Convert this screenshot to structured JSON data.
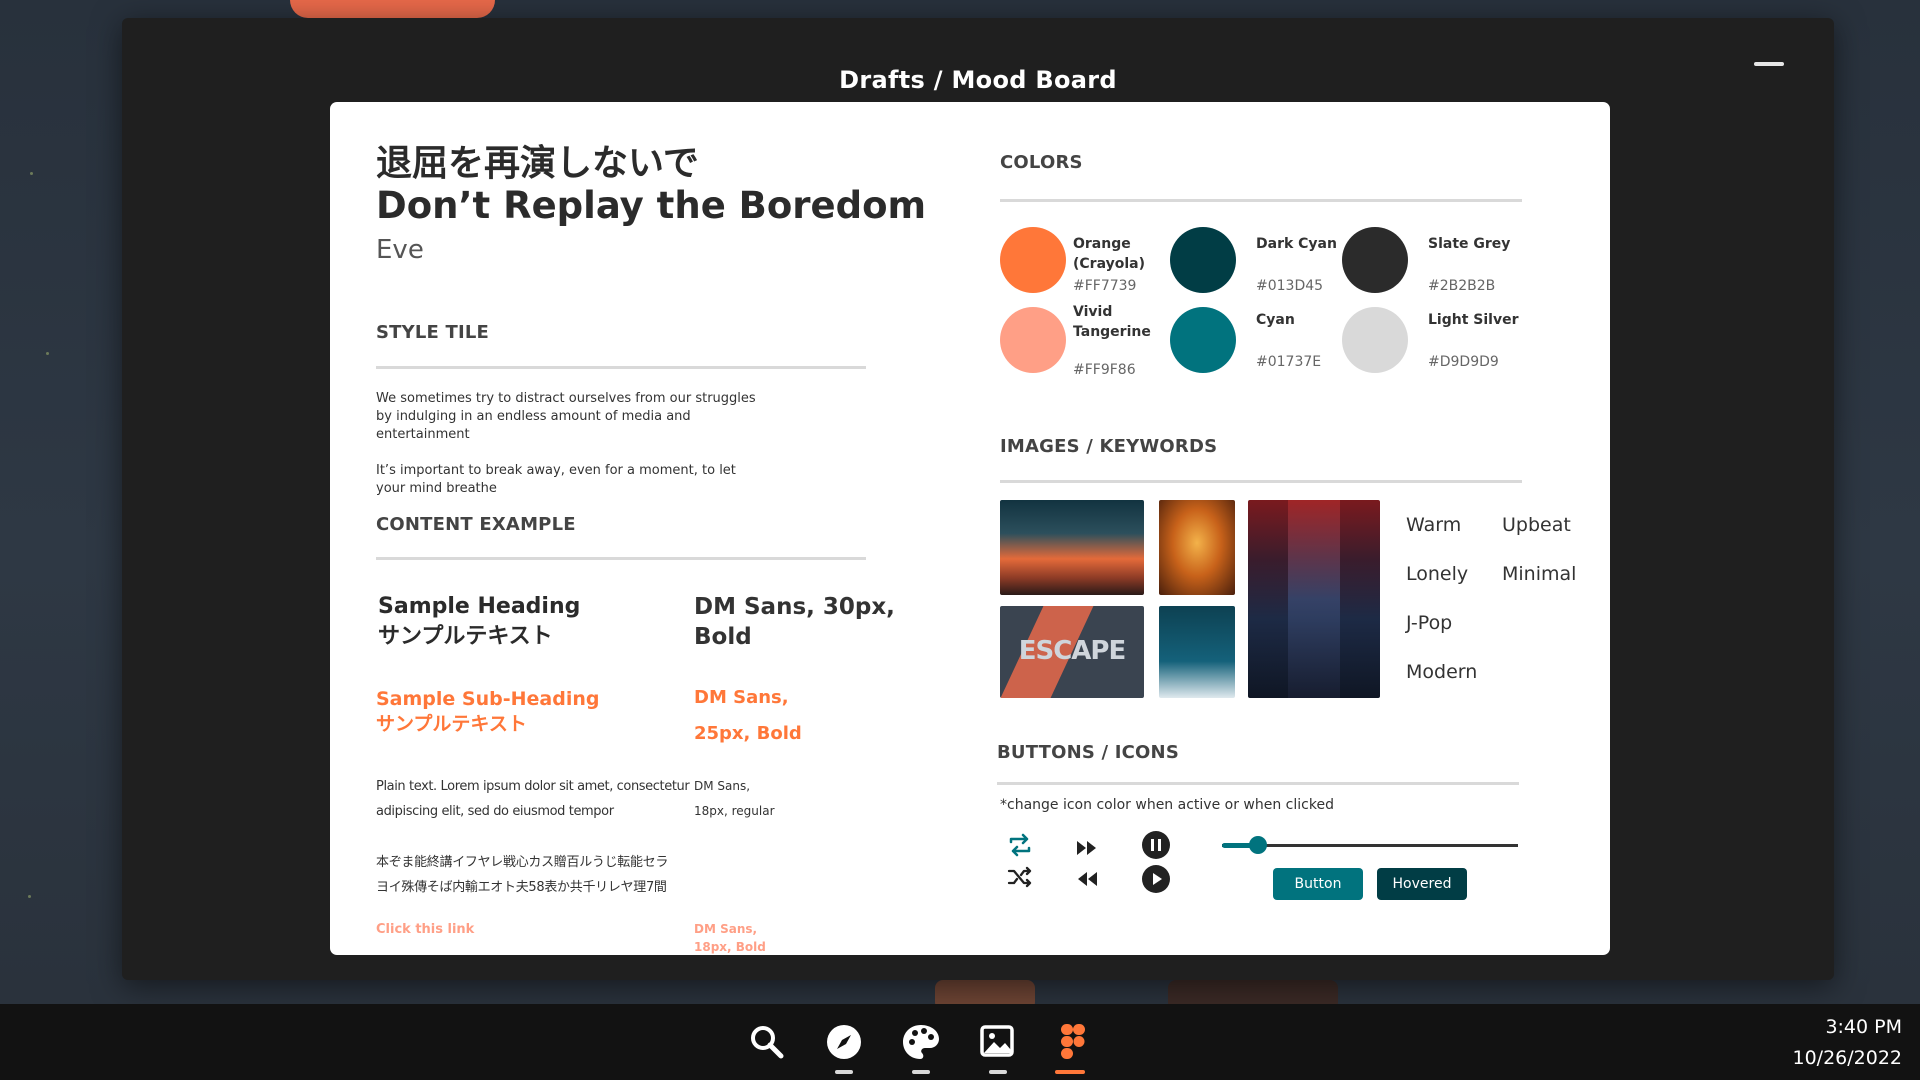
{
  "window": {
    "title": "Drafts / Mood Board"
  },
  "board": {
    "title_jp": "退屈を再演しないで",
    "title_en": "Don’t Replay the Boredom",
    "author": "Eve",
    "style_tile": {
      "heading": "STYLE TILE",
      "paragraphs": [
        "We sometimes try to distract ourselves from our struggles by indulging in an endless amount of media and entertainment",
        "It’s important to break away, even for a moment, to let your mind breathe"
      ]
    },
    "content_example": {
      "heading": "CONTENT EXAMPLE",
      "sample_heading": "Sample Heading",
      "sample_heading_jp": "サンプルテキスト",
      "heading_spec_1": "DM Sans, 30px,",
      "heading_spec_2": "Bold",
      "sample_sub": "Sample Sub-Heading",
      "sample_sub_jp": "サンプルテキスト",
      "sub_spec_1": "DM Sans,",
      "sub_spec_2": "25px, Bold",
      "plain_1": "Plain text. Lorem ipsum dolor sit amet, consectetur",
      "plain_2": "adipiscing elit, sed do eiusmod tempor",
      "plain_spec_1": "DM Sans,",
      "plain_spec_2": "18px, regular",
      "jp_1": "本ぞま能終講イフヤレ戦心カス贈百ルうじ転能セラ",
      "jp_2": "ヨイ殊傳そば内輸エオト夫58表か共千リレヤ理7間",
      "link": "Click this link",
      "link_spec_1": "DM Sans,",
      "link_spec_2": "18px, Bold"
    },
    "colors": {
      "heading": "COLORS",
      "items": [
        {
          "name": "Orange (Crayola)",
          "hex": "#FF7739"
        },
        {
          "name": "Vivid Tangerine",
          "hex": "#FF9F86"
        },
        {
          "name": "Dark Cyan",
          "hex": "#013D45"
        },
        {
          "name": "Cyan",
          "hex": "#01737E"
        },
        {
          "name": "Slate Grey",
          "hex": "#2B2B2B"
        },
        {
          "name": "Light Silver",
          "hex": "#D9D9D9"
        }
      ]
    },
    "images": {
      "heading": "IMAGES / KEYWORDS",
      "escape_text": "ESCAPE",
      "keywords": [
        "Warm",
        "Upbeat",
        "Lonely",
        "Minimal",
        "J-Pop",
        "Modern"
      ]
    },
    "buttons": {
      "heading": "BUTTONS / ICONS",
      "note": "*change icon color when active or when clicked",
      "slider_value": 0.12,
      "button_label": "Button",
      "hovered_label": "Hovered",
      "icons": [
        "repeat-icon",
        "fast-forward-icon",
        "pause-icon",
        "shuffle-icon",
        "rewind-icon",
        "play-icon"
      ]
    }
  },
  "taskbar": {
    "icons": [
      "search-icon",
      "compass-icon",
      "palette-icon",
      "gallery-icon",
      "figma-icon"
    ],
    "active_icon": "figma-icon",
    "time": "3:40 PM",
    "date": "10/26/2022"
  },
  "accent_colors": {
    "orange": "#FF7739",
    "cyan": "#01737E",
    "dark_cyan": "#013D45"
  }
}
